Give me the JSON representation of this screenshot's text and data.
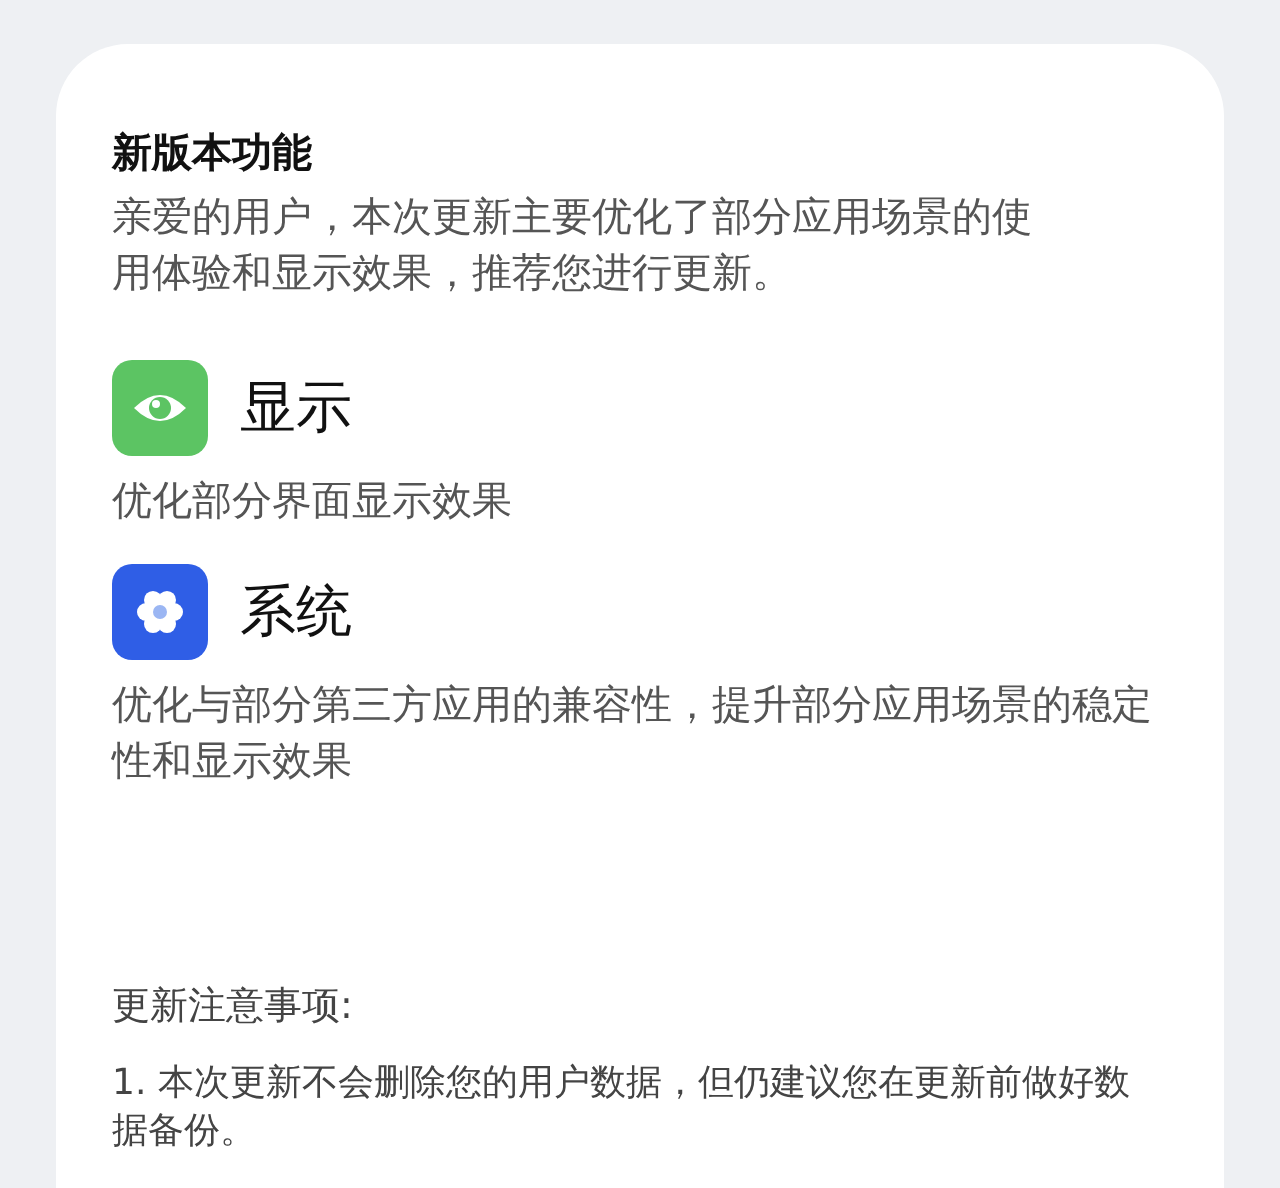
{
  "title": "新版本功能",
  "intro": "亲爱的用户，本次更新主要优化了部分应用场景的使用体验和显示效果，推荐您进行更新。",
  "features": [
    {
      "kind": "eye",
      "color": "#5cc463",
      "name": "显示",
      "description": "优化部分界面显示效果"
    },
    {
      "kind": "gear",
      "color": "#2f5ee6",
      "name": "系统",
      "description": "优化与部分第三方应用的兼容性，提升部分应用场景的稳定性和显示效果"
    }
  ],
  "notes_title": "更新注意事项:",
  "notes": [
    "1. 本次更新不会删除您的用户数据，但仍建议您在更新前做好数据备份。"
  ]
}
